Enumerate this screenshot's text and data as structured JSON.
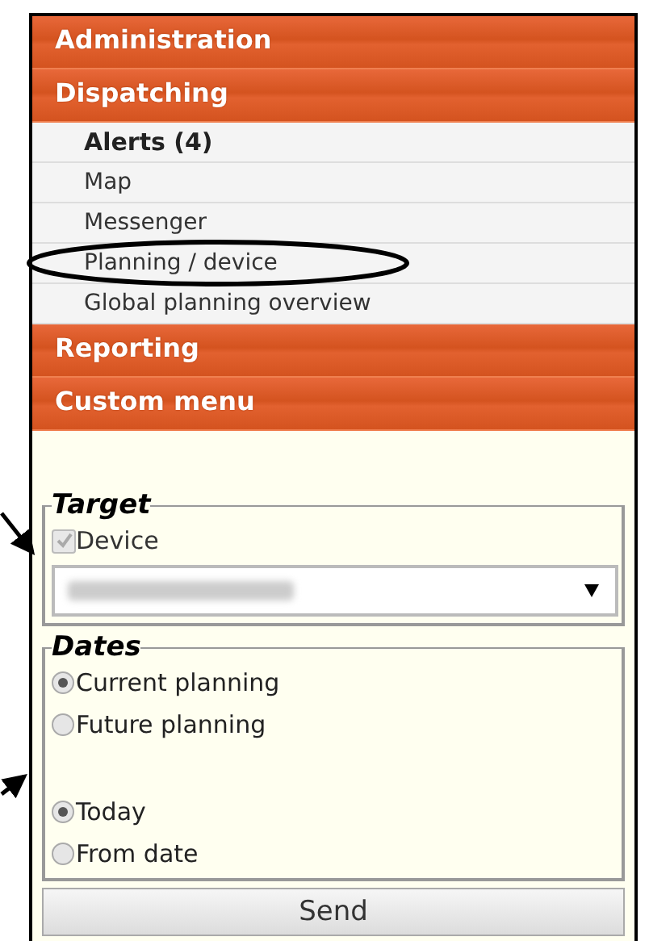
{
  "menu": [
    {
      "kind": "header",
      "label": "Administration"
    },
    {
      "kind": "header",
      "label": "Dispatching"
    },
    {
      "kind": "item",
      "label": "Alerts (4)",
      "selected": true
    },
    {
      "kind": "item",
      "label": "Map",
      "selected": false
    },
    {
      "kind": "item",
      "label": "Messenger",
      "selected": false
    },
    {
      "kind": "item",
      "label": "Planning / device",
      "selected": false
    },
    {
      "kind": "item",
      "label": "Global planning overview",
      "selected": false
    },
    {
      "kind": "header",
      "label": "Reporting"
    },
    {
      "kind": "header",
      "label": "Custom menu"
    }
  ],
  "target": {
    "legend": "Target",
    "checkbox": {
      "label": "Device",
      "checked": true,
      "disabled": true
    }
  },
  "dates": {
    "legend": "Dates",
    "groups": [
      [
        {
          "label": "Current planning",
          "selected": true
        },
        {
          "label": "Future planning",
          "selected": false
        }
      ],
      [
        {
          "label": "Today",
          "selected": true
        },
        {
          "label": "From date",
          "selected": false
        }
      ]
    ]
  },
  "send_button": "Send"
}
